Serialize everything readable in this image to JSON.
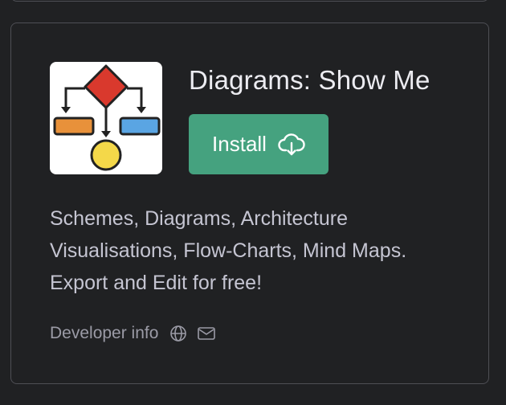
{
  "plugin": {
    "name": "Diagrams: Show Me",
    "install_label": "Install",
    "description": "Schemes, Diagrams, Architecture Visualisations, Flow-Charts, Mind Maps. Export and Edit for free!",
    "developer_info_label": "Developer info"
  },
  "icons": {
    "logo": "flowchart-logo-icon",
    "install": "cloud-download-icon",
    "website": "globe-icon",
    "email": "mail-icon"
  },
  "colors": {
    "background": "#202123",
    "card_border": "#4e4f55",
    "install_button": "#45a27f",
    "title_text": "#ececf1",
    "body_text": "#c5c5d2",
    "muted_text": "#9b9ba6"
  }
}
